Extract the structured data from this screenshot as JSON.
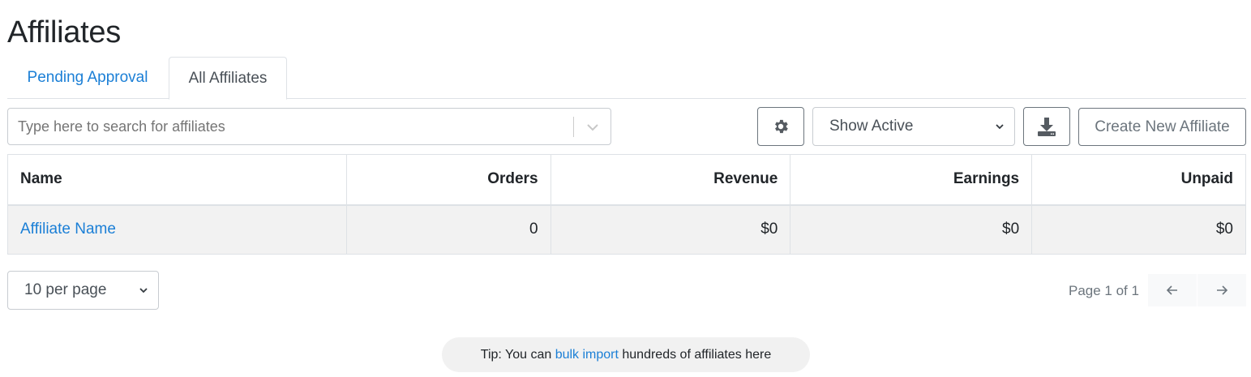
{
  "page": {
    "title": "Affiliates"
  },
  "tabs": [
    {
      "label": "Pending Approval",
      "active": false
    },
    {
      "label": "All Affiliates",
      "active": true
    }
  ],
  "search": {
    "placeholder": "Type here to search for affiliates",
    "value": ""
  },
  "toolbar": {
    "settings_icon": "gear-icon",
    "status_filter": "Show Active",
    "download_icon": "download-icon",
    "create_label": "Create New Affiliate"
  },
  "table": {
    "headers": {
      "name": "Name",
      "orders": "Orders",
      "revenue": "Revenue",
      "earnings": "Earnings",
      "unpaid": "Unpaid"
    },
    "rows": [
      {
        "name": "Affiliate Name",
        "orders": "0",
        "revenue": "$0",
        "earnings": "$0",
        "unpaid": "$0"
      }
    ]
  },
  "pagination": {
    "per_page": "10 per page",
    "page_info": "Page 1 of 1",
    "prev_icon": "arrow-left-icon",
    "next_icon": "arrow-right-icon"
  },
  "tip": {
    "prefix": "Tip: You can ",
    "link": "bulk import",
    "suffix": " hundreds of affiliates here"
  },
  "colors": {
    "link": "#1b7fd6",
    "text": "#212529",
    "muted": "#6c757d",
    "row_bg": "#f2f2f2",
    "tip_bg": "#f1f1f1"
  }
}
